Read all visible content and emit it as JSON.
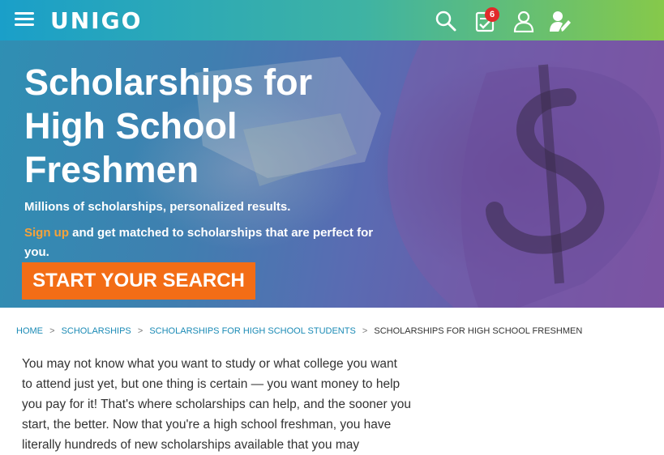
{
  "header": {
    "logo": "UNIGO",
    "badge_count": "6",
    "icons": [
      "menu-icon",
      "search-icon",
      "checklist-icon",
      "user-icon",
      "user-edit-icon"
    ]
  },
  "hero": {
    "title": "Scholarships for High School Freshmen",
    "subtitle": "Millions of scholarships, personalized results.",
    "signup_link": "Sign up",
    "signup_rest": " and get matched to scholarships that are perfect for you.",
    "cta": "START YOUR SEARCH"
  },
  "breadcrumb": {
    "items": [
      "HOME",
      "SCHOLARSHIPS",
      "SCHOLARSHIPS FOR HIGH SCHOOL STUDENTS",
      "SCHOLARSHIPS FOR HIGH SCHOOL FRESHMEN"
    ],
    "separator": ">"
  },
  "content": {
    "paragraph": "You may not know what you want to study or what college you want to attend just yet, but one thing is certain — you want money to help you pay for it! That's where scholarships can help, and the sooner you start, the better. Now that you're a high school freshman, you have literally hundreds of new scholarships available that you may"
  },
  "colors": {
    "header_gradient_start": "#1a9fc9",
    "header_gradient_end": "#86c94a",
    "cta_background": "#f36d16",
    "signup_link": "#f5a23a",
    "breadcrumb_link": "#1a8ab5",
    "badge": "#e12a2a"
  }
}
